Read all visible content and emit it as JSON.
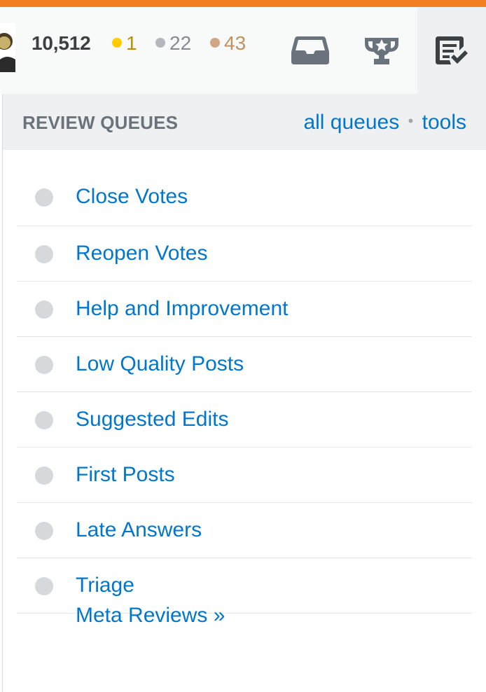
{
  "topbar": {
    "reputation": "10,512",
    "badges": {
      "gold": "1",
      "silver": "22",
      "bronze": "43"
    }
  },
  "review": {
    "title": "REVIEW QUEUES",
    "all_queues_link": "all queues",
    "separator": "•",
    "tools_link": "tools",
    "queues": [
      {
        "label": "Close Votes"
      },
      {
        "label": "Reopen Votes"
      },
      {
        "label": "Help and Improvement"
      },
      {
        "label": "Low Quality Posts"
      },
      {
        "label": "Suggested Edits"
      },
      {
        "label": "First Posts"
      },
      {
        "label": "Late Answers"
      },
      {
        "label": "Triage"
      }
    ],
    "meta_link": "Meta Reviews »"
  },
  "icons": {
    "inbox": "inbox-icon",
    "achievements": "trophy-icon",
    "review": "review-queue-icon"
  },
  "colors": {
    "accent": "#f48024",
    "link": "#0077cc",
    "gold": "#ffcc01",
    "silver": "#b4b8bc",
    "bronze": "#d1a684"
  }
}
